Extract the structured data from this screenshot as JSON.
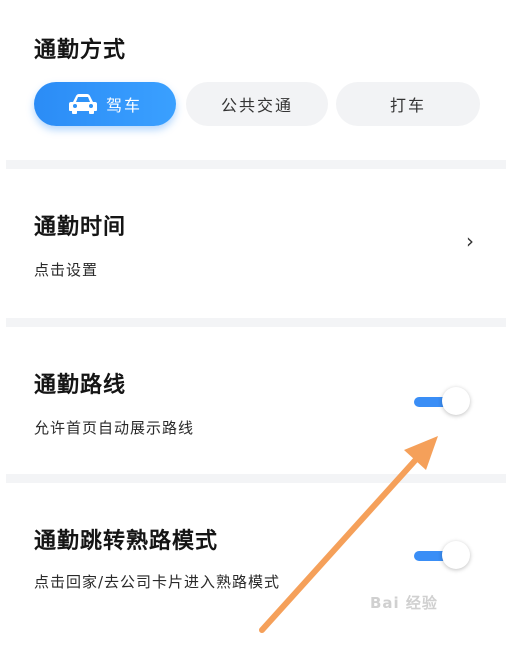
{
  "commute_mode": {
    "title": "通勤方式",
    "options": [
      {
        "label": "驾车",
        "active": true,
        "icon": "car-icon"
      },
      {
        "label": "公共交通",
        "active": false
      },
      {
        "label": "打车",
        "active": false
      }
    ]
  },
  "commute_time": {
    "title": "通勤时间",
    "subtitle": "点击设置",
    "chevron": "›"
  },
  "commute_route": {
    "title": "通勤路线",
    "subtitle": "允许首页自动展示路线",
    "toggle_on": true
  },
  "familiar_mode": {
    "title": "通勤跳转熟路模式",
    "subtitle": "点击回家/去公司卡片进入熟路模式",
    "toggle_on": true
  },
  "watermark": "Bai 经验",
  "colors": {
    "accent": "#2b8cf6",
    "arrow": "#f5a05a",
    "divider": "#f3f4f6"
  }
}
